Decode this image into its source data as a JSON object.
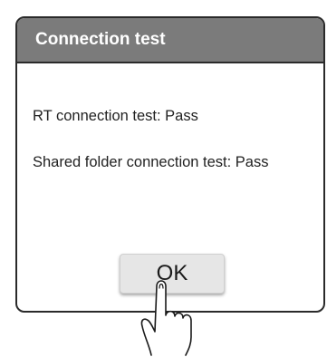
{
  "dialog": {
    "title": "Connection test",
    "results": {
      "rt": "RT connection test: Pass",
      "shared_folder": "Shared folder connection test: Pass"
    },
    "ok_label": "OK"
  },
  "colors": {
    "header_bg": "#7b7b7b",
    "header_text": "#ffffff",
    "border": "#2a2a2a",
    "button_bg": "#e6e6e6"
  },
  "icons": {
    "pointer": "pointing-hand-icon"
  }
}
